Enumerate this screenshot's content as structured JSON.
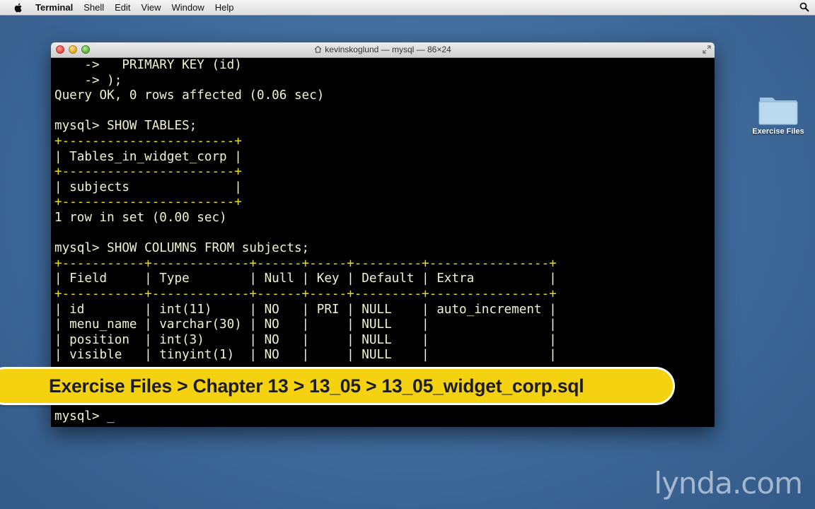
{
  "menubar": {
    "app_name": "Terminal",
    "items": [
      "Shell",
      "Edit",
      "View",
      "Window",
      "Help"
    ]
  },
  "window": {
    "title": "kevinskoglund — mysql — 86×24"
  },
  "terminal": {
    "lines": [
      "    ->   PRIMARY KEY (id)",
      "    -> );",
      "Query OK, 0 rows affected (0.06 sec)",
      "",
      "mysql> SHOW TABLES;",
      "+-----------------------+",
      "| Tables_in_widget_corp |",
      "+-----------------------+",
      "| subjects              |",
      "+-----------------------+",
      "1 row in set (0.00 sec)",
      "",
      "mysql> SHOW COLUMNS FROM subjects;",
      "+-----------+-------------+------+-----+---------+----------------+",
      "| Field     | Type        | Null | Key | Default | Extra          |",
      "+-----------+-------------+------+-----+---------+----------------+",
      "| id        | int(11)     | NO   | PRI | NULL    | auto_increment |",
      "| menu_name | varchar(30) | NO   |     | NULL    |                |",
      "| position  | int(3)      | NO   |     | NULL    |                |",
      "| visible   | tinyint(1)  | NO   |     | NULL    |                |",
      "",
      "",
      "",
      "mysql> "
    ],
    "cursor": "_"
  },
  "banner": {
    "text": "Exercise Files > Chapter 13 > 13_05 > 13_05_widget_corp.sql"
  },
  "desktop": {
    "folder_label": "Exercise Files"
  },
  "watermark": "lynda.com"
}
